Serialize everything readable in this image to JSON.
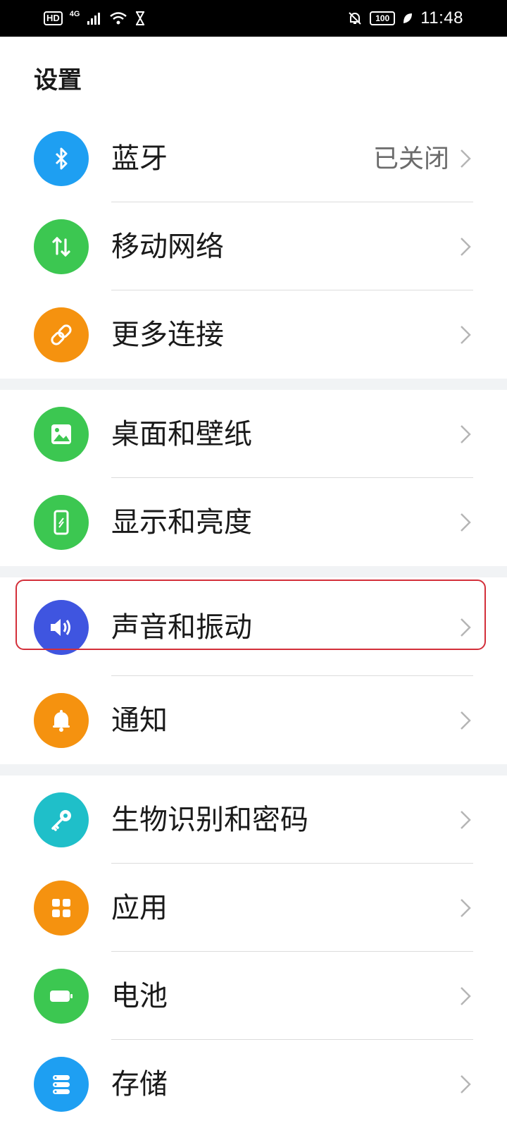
{
  "status_bar": {
    "hd": "HD",
    "network": "4G",
    "battery": "100",
    "time": "11:48"
  },
  "page": {
    "title": "设置"
  },
  "groups": [
    {
      "items": [
        {
          "label": "蓝牙",
          "value": "已关闭",
          "icon": "bluetooth-icon",
          "color": "#1e9ff2"
        },
        {
          "label": "移动网络",
          "icon": "mobile-data-icon",
          "color": "#3cc751"
        },
        {
          "label": "更多连接",
          "icon": "link-icon",
          "color": "#f5920f"
        }
      ]
    },
    {
      "items": [
        {
          "label": "桌面和壁纸",
          "icon": "image-icon",
          "color": "#3cc751"
        },
        {
          "label": "显示和亮度",
          "icon": "phone-display-icon",
          "color": "#3cc751"
        }
      ]
    },
    {
      "items": [
        {
          "label": "声音和振动",
          "icon": "speaker-icon",
          "color": "#3f55e0"
        },
        {
          "label": "通知",
          "icon": "bell-icon",
          "color": "#f5920f"
        }
      ]
    },
    {
      "items": [
        {
          "label": "生物识别和密码",
          "icon": "key-icon",
          "color": "#1fbfc9"
        },
        {
          "label": "应用",
          "icon": "apps-grid-icon",
          "color": "#f5920f"
        },
        {
          "label": "电池",
          "icon": "battery-icon",
          "color": "#3cc751"
        },
        {
          "label": "存储",
          "icon": "storage-icon",
          "color": "#1e9ff2"
        }
      ]
    }
  ],
  "highlight_color": "#d32f3a"
}
